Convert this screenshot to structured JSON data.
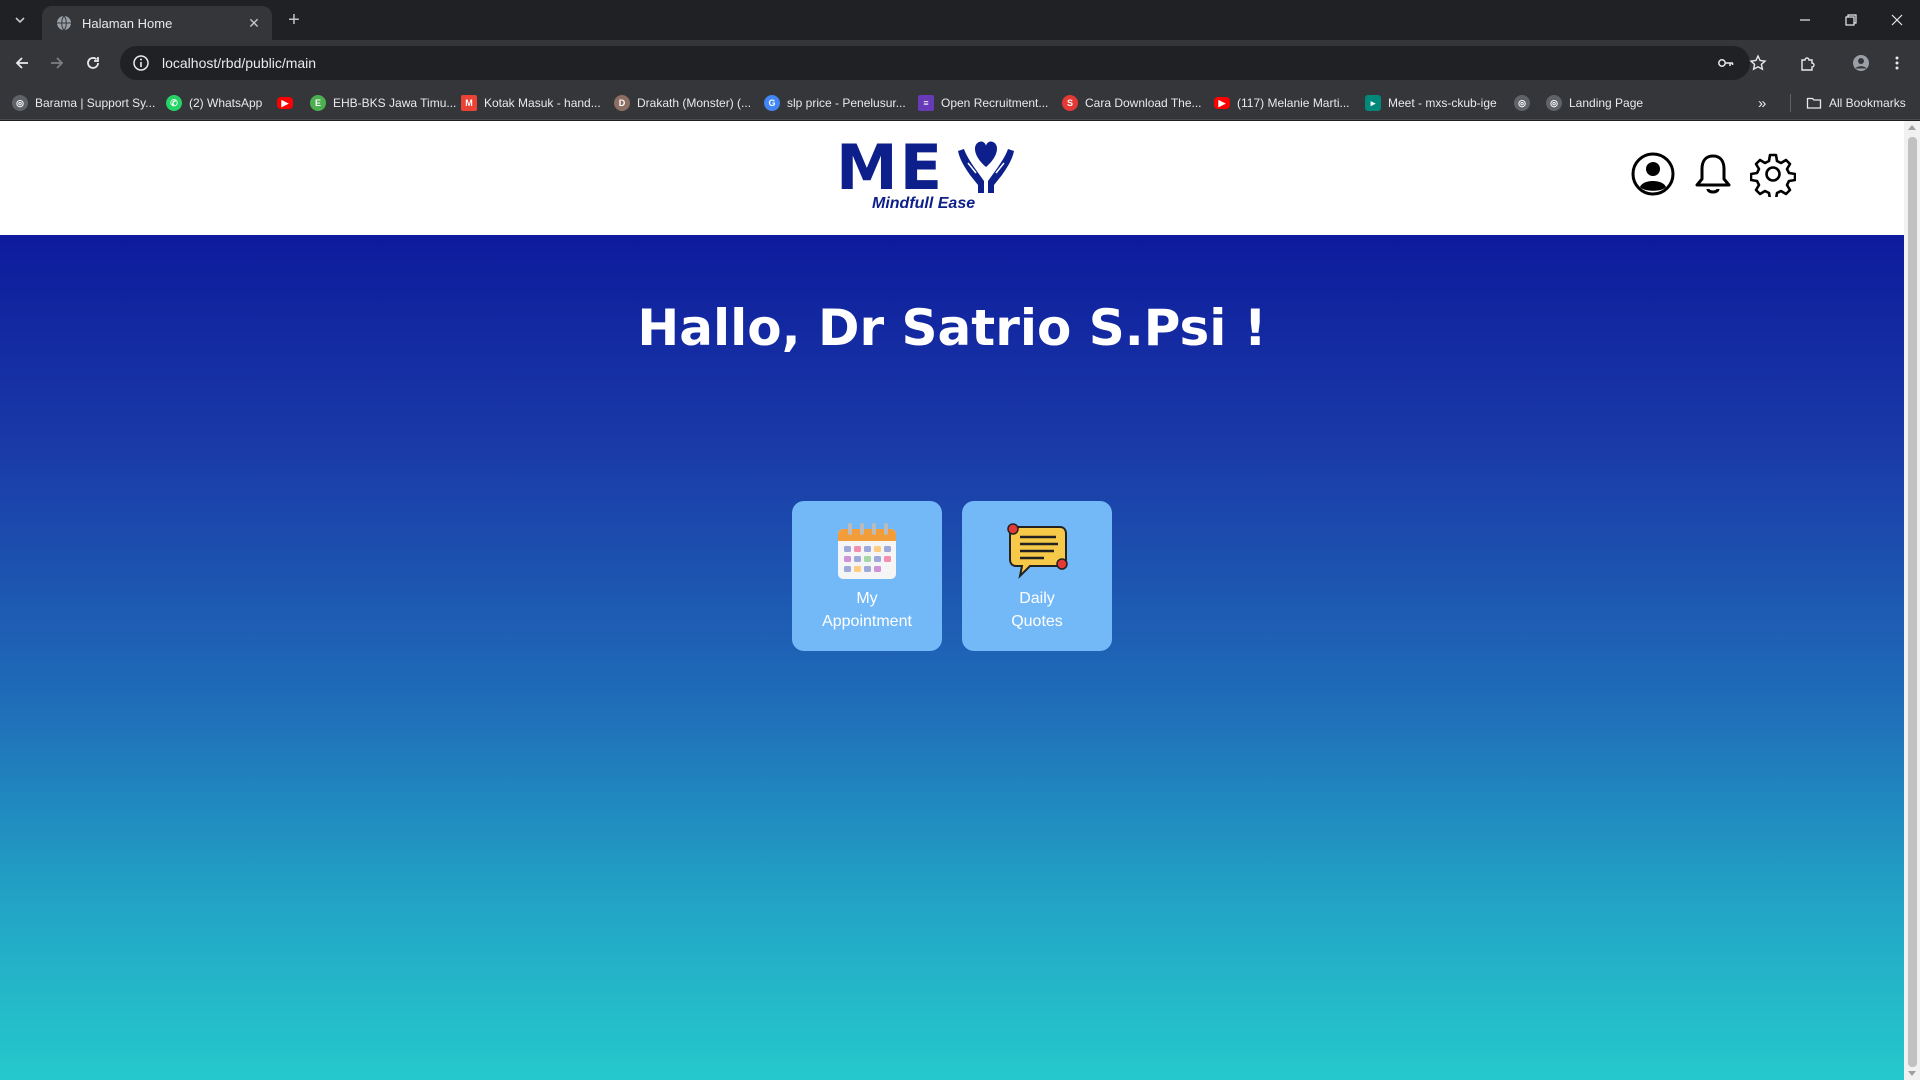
{
  "browser": {
    "tab_title": "Halaman Home",
    "tab_close": "✕",
    "new_tab": "+",
    "url": "localhost/rbd/public/main",
    "bookmarks": [
      {
        "label": "Barama | Support Sy...",
        "icon": "globe-icon",
        "color": "#5f6368"
      },
      {
        "label": "(2) WhatsApp",
        "icon": "whatsapp-icon",
        "color": "#25d366"
      },
      {
        "label": "",
        "icon": "youtube-icon",
        "color": "#ff0000"
      },
      {
        "label": "EHB-BKS Jawa Timu...",
        "icon": "site-icon",
        "color": "#4caf50"
      },
      {
        "label": "Kotak Masuk - hand...",
        "icon": "gmail-icon",
        "color": "#ea4335"
      },
      {
        "label": "Drakath (Monster) (...",
        "icon": "site-icon",
        "color": "#8d6e63"
      },
      {
        "label": "slp price - Penelusur...",
        "icon": "google-icon",
        "color": "#4285f4"
      },
      {
        "label": "Open Recruitment...",
        "icon": "forms-icon",
        "color": "#673ab7"
      },
      {
        "label": "Cara Download The...",
        "icon": "site-icon",
        "color": "#e53935"
      },
      {
        "label": "(117) Melanie Marti...",
        "icon": "youtube-icon",
        "color": "#ff0000"
      },
      {
        "label": "Meet - mxs-ckub-ige",
        "icon": "meet-icon",
        "color": "#00897b"
      },
      {
        "label": "",
        "icon": "globe-icon",
        "color": "#5f6368"
      },
      {
        "label": "Landing Page",
        "icon": "globe-icon",
        "color": "#5f6368"
      }
    ],
    "all_bookmarks": "All Bookmarks",
    "more": "»"
  },
  "site": {
    "logo_text": "ME",
    "logo_sub": "Mindfull Ease",
    "greeting": "Hallo, Dr Satrio S.Psi !",
    "cards": [
      {
        "label_line1": "My",
        "label_line2": "Appointment",
        "icon": "calendar-icon"
      },
      {
        "label_line1": "Daily",
        "label_line2": "Quotes",
        "icon": "chat-bubble-icon"
      }
    ]
  },
  "colors": {
    "brand": "#0d1f8a",
    "card": "#74b9f7",
    "gradient_top": "#0d1b9c",
    "gradient_bottom": "#25c9cc"
  }
}
